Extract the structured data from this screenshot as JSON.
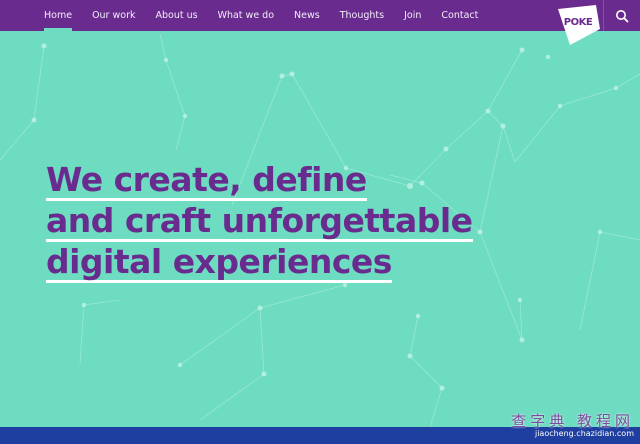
{
  "nav": {
    "items": [
      {
        "label": "Home",
        "active": true
      },
      {
        "label": "Our work"
      },
      {
        "label": "About us"
      },
      {
        "label": "What we do"
      },
      {
        "label": "News"
      },
      {
        "label": "Thoughts"
      },
      {
        "label": "Join"
      },
      {
        "label": "Contact"
      }
    ]
  },
  "logo": {
    "text": "POKE"
  },
  "search": {
    "icon": "search-icon"
  },
  "hero": {
    "lines": [
      "We create, define",
      "and craft unforgettable",
      "digital experiences"
    ]
  },
  "watermark": {
    "line1": "查字典 教程网",
    "line2": "jiaocheng.chazidian.com"
  },
  "colors": {
    "background": "#6ddcc0",
    "topbar": "#6a2b8f",
    "headline": "#6a2b8f",
    "underline": "#ffffff",
    "footer": "#1e3ea0"
  }
}
